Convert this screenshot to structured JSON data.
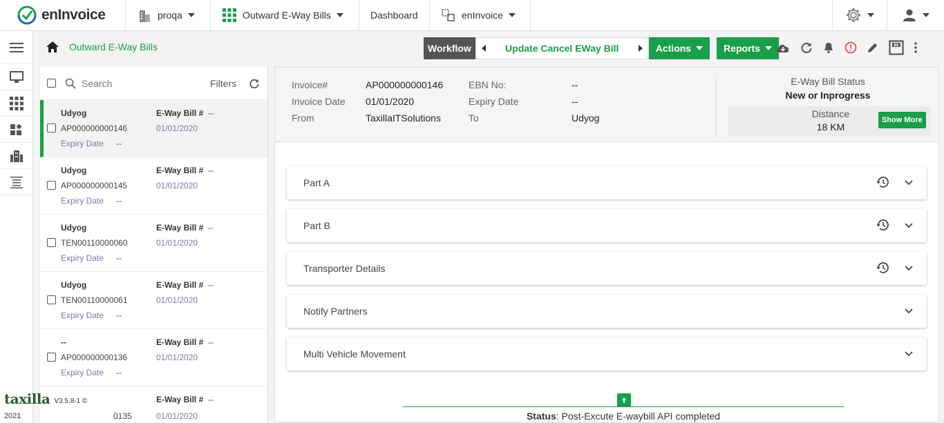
{
  "header": {
    "app_name": "enInvoice",
    "org": "proqa",
    "module": "Outward E-Way Bills",
    "dashboard": "Dashboard",
    "app_switch": "enInvoice"
  },
  "breadcrumb": {
    "title": "Outward E-Way Bills"
  },
  "workflow": {
    "label": "Workflow",
    "step": "Update Cancel EWay Bill"
  },
  "actions": {
    "actions_label": "Actions",
    "reports_label": "Reports"
  },
  "list": {
    "search_placeholder": "Search",
    "filters_label": "Filters",
    "items": [
      {
        "party": "Udyog",
        "invoice": "AP000000000146",
        "expiry_label": "Expiry Date",
        "expiry_value": "--",
        "ewb_label": "E-Way Bill #",
        "ewb_value": "--",
        "date": "01/01/2020"
      },
      {
        "party": "Udyog",
        "invoice": "AP000000000145",
        "expiry_label": "Expiry Date",
        "expiry_value": "--",
        "ewb_label": "E-Way Bill #",
        "ewb_value": "--",
        "date": "01/01/2020"
      },
      {
        "party": "Udyog",
        "invoice": "TEN00110000060",
        "expiry_label": "Expiry Date",
        "expiry_value": "--",
        "ewb_label": "E-Way Bill #",
        "ewb_value": "--",
        "date": "01/01/2020"
      },
      {
        "party": "Udyog",
        "invoice": "TEN00110000061",
        "expiry_label": "Expiry Date",
        "expiry_value": "--",
        "ewb_label": "E-Way Bill #",
        "ewb_value": "--",
        "date": "01/01/2020"
      },
      {
        "party": "--",
        "invoice": "AP000000000136",
        "expiry_label": "Expiry Date",
        "expiry_value": "--",
        "ewb_label": "E-Way Bill #",
        "ewb_value": "--",
        "date": "01/01/2020"
      },
      {
        "party": "",
        "invoice": "0135",
        "expiry_label": "",
        "expiry_value": "",
        "ewb_label": "E-Way Bill #",
        "ewb_value": "--",
        "date": "01/01/2020"
      }
    ]
  },
  "footer": {
    "brand": "taxilla",
    "version": "V3.5.8-1 ©",
    "year": "2021"
  },
  "summary": {
    "invoice_label": "Invoice#",
    "invoice_value": "AP000000000146",
    "date_label": "Invoice Date",
    "date_value": "01/01/2020",
    "from_label": "From",
    "from_value": "TaxillaITSolutions",
    "ebn_label": "EBN No:",
    "ebn_value": "--",
    "expiry_label": "Expiry Date",
    "expiry_value": "--",
    "to_label": "To",
    "to_value": "Udyog",
    "status_label": "E-Way Bill Status",
    "status_value": "New or Inprogress",
    "distance_label": "Distance",
    "distance_value": "18 KM",
    "show_more": "Show More"
  },
  "sections": [
    {
      "label": "Part A",
      "history": true
    },
    {
      "label": "Part B",
      "history": true
    },
    {
      "label": "Transporter Details",
      "history": true
    },
    {
      "label": "Notify Partners",
      "history": false
    },
    {
      "label": "Multi Vehicle Movement",
      "history": false
    }
  ],
  "status_bar": {
    "label": "Status",
    "text": ": Post-Excute E-waybill API completed"
  },
  "colors": {
    "accent": "#1a9e49",
    "dark": "#555555",
    "alert": "#e53935"
  }
}
